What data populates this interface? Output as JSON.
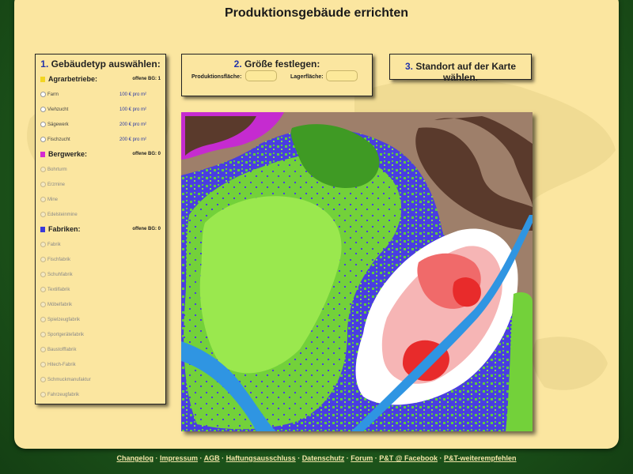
{
  "title": "Produktionsgebäude errichten",
  "step1": {
    "num": "1.",
    "title": "Gebäudetyp auswählen:",
    "categories": [
      {
        "label": "Agrarbetriebe:",
        "open": "offene BG: 1",
        "color": "#f2d522",
        "items": [
          {
            "label": "Farm",
            "price": "100 € pro m²"
          },
          {
            "label": "Viehzucht",
            "price": "100 € pro m²"
          },
          {
            "label": "Sägewerk",
            "price": "200 € pro m²"
          },
          {
            "label": "Fischzucht",
            "price": "200 € pro m²"
          }
        ]
      },
      {
        "label": "Bergwerke:",
        "open": "offene BG: 0",
        "color": "#d42ad1",
        "items": [
          {
            "label": "Bohrturm"
          },
          {
            "label": "Erzmine"
          },
          {
            "label": "Mine"
          },
          {
            "label": "Edelsteinmine"
          }
        ]
      },
      {
        "label": "Fabriken:",
        "open": "offene BG: 0",
        "color": "#3a3ad8",
        "items": [
          {
            "label": "Fabrik"
          },
          {
            "label": "Fischfabrik"
          },
          {
            "label": "Schuhfabrik"
          },
          {
            "label": "Textilfabrik"
          },
          {
            "label": "Möbelfabrik"
          },
          {
            "label": "Spielzeugfabrik"
          },
          {
            "label": "Sportgerätefabrik"
          },
          {
            "label": "Baustofffabrik"
          },
          {
            "label": "Hitech-Fabrik"
          },
          {
            "label": "Schmuckmanufaktur"
          },
          {
            "label": "Fahrzeugfabrik"
          }
        ]
      }
    ]
  },
  "step2": {
    "num": "2.",
    "title": "Größe festlegen:",
    "prod_label": "Produktionsfläche:",
    "store_label": "Lagerfläche:",
    "prod_value": "",
    "store_value": ""
  },
  "step3": {
    "num": "3.",
    "title": "Standort auf der Karte wählen."
  },
  "footer": {
    "links": [
      "Changelog",
      "Impressum",
      "AGB",
      "Haftungsausschluss",
      "Datenschutz",
      "Forum",
      "P&T @ Facebook",
      "P&T-weiterempfehlen"
    ]
  },
  "colors": {
    "panel": "#fbe6a0",
    "step_number": "#2233aa",
    "price": "#2b3aa5"
  }
}
